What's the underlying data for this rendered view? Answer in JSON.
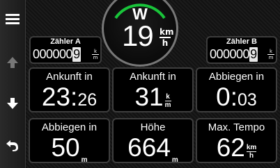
{
  "trip_a": {
    "label": "Zähler A",
    "digits": "000000",
    "last_digit": "9",
    "unit_top": "k",
    "unit_bottom": "m"
  },
  "trip_b": {
    "label": "Zähler B",
    "digits": "000000",
    "last_digit": "9",
    "unit_top": "k",
    "unit_bottom": "m"
  },
  "compass": {
    "heading": "W",
    "speed": "19",
    "unit_top": "km",
    "unit_bottom": "h",
    "arc_color": "#19c43a"
  },
  "tiles": [
    {
      "title": "Ankunft in",
      "value": "23",
      "sep": ":",
      "small": "26"
    },
    {
      "title": "Ankunft in",
      "value": "31",
      "unit_top": "k",
      "unit_bottom": "m"
    },
    {
      "title": "Abbiegen in",
      "value": "0",
      "sep": ":",
      "small": "03"
    },
    {
      "title": "Abbiegen in",
      "value": "50",
      "unit": "m"
    },
    {
      "title": "Höhe",
      "value": "664",
      "unit": "m"
    },
    {
      "title": "Max. Tempo",
      "value": "62",
      "unit_top": "km",
      "unit_bottom": "h"
    }
  ],
  "sidebar": [
    {
      "icon": "menu-icon"
    },
    {
      "icon": "arrow-up-icon"
    },
    {
      "icon": "arrow-down-icon"
    },
    {
      "icon": "back-icon"
    }
  ]
}
